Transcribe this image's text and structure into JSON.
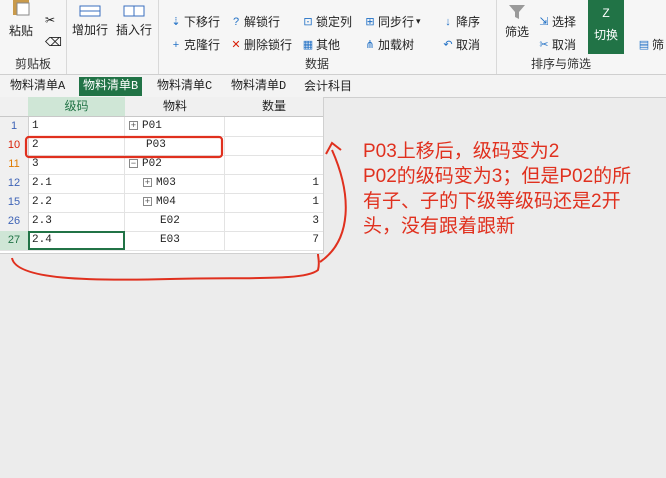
{
  "ribbon": {
    "clipboard": {
      "paste": "粘贴",
      "group_label": "剪贴板"
    },
    "rows_group": {
      "add_row": "增加行",
      "insert_row": "插入行"
    },
    "data_group": {
      "move_down": "下移行",
      "unlock": "解锁行",
      "clone_row": "克隆行",
      "delete_lock": "删除锁行",
      "lock_col": "锁定列",
      "step_row": "同步行",
      "other": "其他",
      "load_tree": "加载树",
      "group_label": "数据"
    },
    "sort_group": {
      "desc": "降序",
      "cancel": "取消"
    },
    "filter_group": {
      "filter": "筛选",
      "select": "选择",
      "cancel": "取消",
      "switch": "切换",
      "group_label": "排序与筛选",
      "filter_right": "筛"
    }
  },
  "tabs": [
    {
      "label": "物料清单A"
    },
    {
      "label": "物料清单B"
    },
    {
      "label": "物料清单C"
    },
    {
      "label": "物料清单D"
    },
    {
      "label": "会计科目"
    }
  ],
  "grid": {
    "headers": [
      "级码",
      "物料",
      "数量"
    ],
    "rows": [
      {
        "num": "1",
        "code": "1",
        "toggle": "+",
        "material": "P01",
        "qty": ""
      },
      {
        "num": "10",
        "code": "2",
        "toggle": "",
        "material": "P03",
        "qty": ""
      },
      {
        "num": "11",
        "code": "3",
        "toggle": "−",
        "material": "P02",
        "qty": ""
      },
      {
        "num": "12",
        "code": "2.1",
        "toggle": "+",
        "material": "M03",
        "qty": "1"
      },
      {
        "num": "15",
        "code": "2.2",
        "toggle": "+",
        "material": "M04",
        "qty": "1"
      },
      {
        "num": "26",
        "code": "2.3",
        "toggle": "",
        "material": "E02",
        "qty": "3"
      },
      {
        "num": "27",
        "code": "2.4",
        "toggle": "",
        "material": "E03",
        "qty": "7"
      }
    ]
  },
  "annotation": {
    "lines": [
      "P03上移后，级码变为2",
      "P02的级码变为3；但是P02的所",
      "有子、子的下级等级码还是2开",
      "头，没有跟着跟新"
    ],
    "color": "#e0301e"
  },
  "colors": {
    "accent": "#217346",
    "annotation_red": "#e0301e"
  }
}
